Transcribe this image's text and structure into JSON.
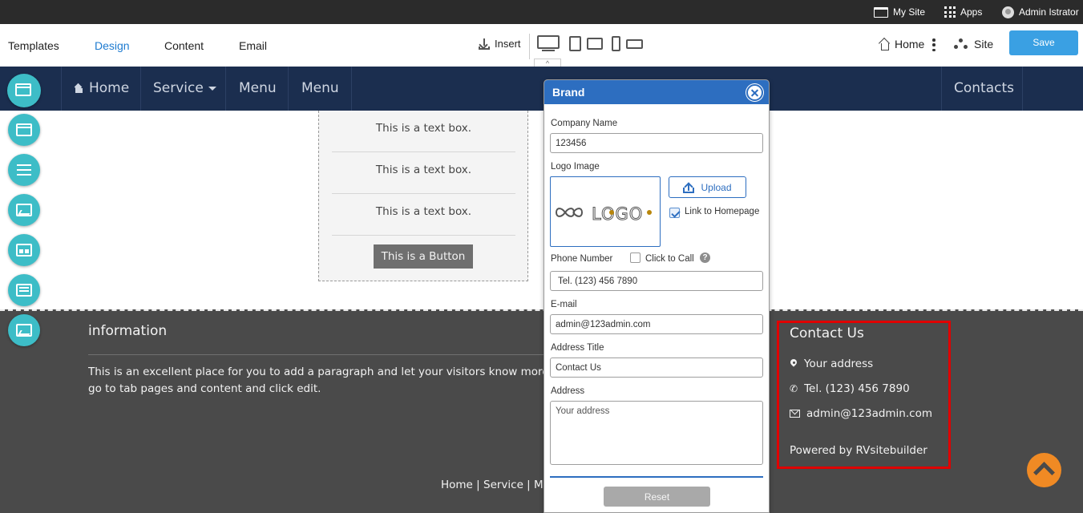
{
  "admin_bar": {
    "my_site": "My Site",
    "apps": "Apps",
    "user": "Admin Istrator"
  },
  "toolbar": {
    "tabs": [
      {
        "label": "Templates",
        "active": false
      },
      {
        "label": "Design",
        "active": true
      },
      {
        "label": "Content",
        "active": false
      },
      {
        "label": "Email",
        "active": false
      }
    ],
    "insert": "Insert",
    "devices": [
      "desktop-icon",
      "tablet-icon",
      "mobile-icon"
    ],
    "collapse_glyph": "^",
    "home": "Home",
    "site": "Site",
    "save": "Save",
    "accent": "#1e7bd0"
  },
  "site_nav": {
    "items": [
      "Home",
      "Service",
      "Menu",
      "Menu"
    ],
    "right_item": "Contacts",
    "background": "#1b2e4f"
  },
  "content": {
    "text_boxes": [
      "This is a text box.",
      "This is a text box.",
      "This is a text box."
    ],
    "button": "This is a Button"
  },
  "footer": {
    "info_title": "information",
    "info_text_1": "This is an excellent place for you to add a paragraph and let your visitors know more ab",
    "info_text_2": "go to tab pages and content and click edit.",
    "links": "Home | Service | M",
    "contact": {
      "title": "Contact Us",
      "address": "Your address",
      "phone": "Tel. (123) 456 7890",
      "email": "admin@123admin.com",
      "powered": "Powered by RVsitebuilder"
    },
    "scroll_top_color": "#f08a24"
  },
  "left_tools": [
    "header-block-icon",
    "section-block-icon",
    "list-block-icon",
    "image-block-icon",
    "grid-block-icon",
    "footer-block-icon",
    "gallery-block-icon"
  ],
  "dialog": {
    "title": "Brand",
    "company_label": "Company Name",
    "company_value": "123456",
    "logo_label": "Logo Image",
    "logo_text": "LOGO",
    "upload": "Upload",
    "link_home_label": "Link to Homepage",
    "link_home_checked": true,
    "phone_label": "Phone Number",
    "click_to_call_label": "Click to Call",
    "click_to_call_checked": false,
    "help_glyph": "?",
    "phone_value": " Tel. (123) 456 7890",
    "email_label": "E-mail",
    "email_value": "admin@123admin.com",
    "address_title_label": "Address Title",
    "address_title_value": "Contact Us",
    "address_label": "Address",
    "address_value": "Your address",
    "reset": "Reset",
    "header_color": "#2d6ec0"
  }
}
